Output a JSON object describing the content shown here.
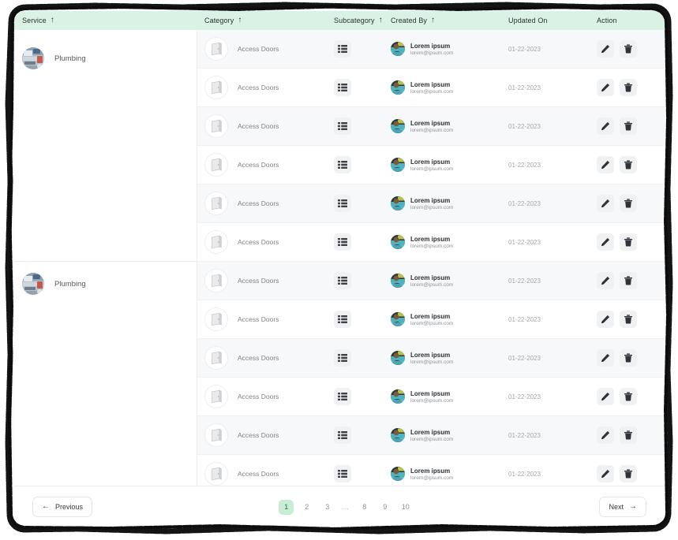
{
  "theme": {
    "header_bg": "#d9f2e3",
    "active_page_bg": "#c9ecd5",
    "active_page_fg": "#2f6b45",
    "row_alt_bg": "#f7f8f9",
    "icon_btn_bg": "#f0f1f3"
  },
  "table": {
    "columns": [
      {
        "key": "service",
        "label": "Service",
        "sortable": true,
        "sort_icon": "sort-arrow-up-icon"
      },
      {
        "key": "category",
        "label": "Category",
        "sortable": true,
        "sort_icon": "sort-arrow-up-icon"
      },
      {
        "key": "subcategory",
        "label": "Subcategory",
        "sortable": true,
        "sort_icon": "sort-arrow-up-icon"
      },
      {
        "key": "created_by",
        "label": "Created By",
        "sortable": true,
        "sort_icon": "sort-arrow-up-icon"
      },
      {
        "key": "updated_on",
        "label": "Updated On",
        "sortable": false,
        "sort_icon": ""
      },
      {
        "key": "action",
        "label": "Action",
        "sortable": false,
        "sort_icon": ""
      }
    ],
    "groups": [
      {
        "service": "Plumbing",
        "avatar": "plumbing-tools-photo",
        "row_count": 6
      },
      {
        "service": "Plumbing",
        "avatar": "plumbing-tools-photo",
        "row_count": 6
      }
    ],
    "rows": [
      {
        "category": "Access Doors",
        "category_thumb": "access-door-photo",
        "subcategory_icon": "list-view-icon",
        "created_by_name": "Lorem ipsum",
        "created_by_email": "lorem@ipsum.com",
        "created_by_avatar": "person-photo",
        "updated_on": "01-22-2023",
        "edit_icon": "pencil-icon",
        "delete_icon": "trash-icon"
      },
      {
        "category": "Access Doors",
        "category_thumb": "access-door-photo",
        "subcategory_icon": "list-view-icon",
        "created_by_name": "Lorem ipsum",
        "created_by_email": "lorem@ipsum.com",
        "created_by_avatar": "person-photo",
        "updated_on": "01-22-2023",
        "edit_icon": "pencil-icon",
        "delete_icon": "trash-icon"
      },
      {
        "category": "Access Doors",
        "category_thumb": "access-door-photo",
        "subcategory_icon": "list-view-icon",
        "created_by_name": "Lorem ipsum",
        "created_by_email": "lorem@ipsum.com",
        "created_by_avatar": "person-photo",
        "updated_on": "01-22-2023",
        "edit_icon": "pencil-icon",
        "delete_icon": "trash-icon"
      },
      {
        "category": "Access Doors",
        "category_thumb": "access-door-photo",
        "subcategory_icon": "list-view-icon",
        "created_by_name": "Lorem ipsum",
        "created_by_email": "lorem@ipsum.com",
        "created_by_avatar": "person-photo",
        "updated_on": "01-22-2023",
        "edit_icon": "pencil-icon",
        "delete_icon": "trash-icon"
      },
      {
        "category": "Access Doors",
        "category_thumb": "access-door-photo",
        "subcategory_icon": "list-view-icon",
        "created_by_name": "Lorem ipsum",
        "created_by_email": "lorem@ipsum.com",
        "created_by_avatar": "person-photo",
        "updated_on": "01-22-2023",
        "edit_icon": "pencil-icon",
        "delete_icon": "trash-icon"
      },
      {
        "category": "Access Doors",
        "category_thumb": "access-door-photo",
        "subcategory_icon": "list-view-icon",
        "created_by_name": "Lorem ipsum",
        "created_by_email": "lorem@ipsum.com",
        "created_by_avatar": "person-photo",
        "updated_on": "01-22-2023",
        "edit_icon": "pencil-icon",
        "delete_icon": "trash-icon"
      },
      {
        "category": "Access Doors",
        "category_thumb": "access-door-photo",
        "subcategory_icon": "list-view-icon",
        "created_by_name": "Lorem ipsum",
        "created_by_email": "lorem@ipsum.com",
        "created_by_avatar": "person-photo",
        "updated_on": "01-22-2023",
        "edit_icon": "pencil-icon",
        "delete_icon": "trash-icon"
      },
      {
        "category": "Access Doors",
        "category_thumb": "access-door-photo",
        "subcategory_icon": "list-view-icon",
        "created_by_name": "Lorem ipsum",
        "created_by_email": "lorem@ipsum.com",
        "created_by_avatar": "person-photo",
        "updated_on": "01-22-2023",
        "edit_icon": "pencil-icon",
        "delete_icon": "trash-icon"
      },
      {
        "category": "Access Doors",
        "category_thumb": "access-door-photo",
        "subcategory_icon": "list-view-icon",
        "created_by_name": "Lorem ipsum",
        "created_by_email": "lorem@ipsum.com",
        "created_by_avatar": "person-photo",
        "updated_on": "01-22-2023",
        "edit_icon": "pencil-icon",
        "delete_icon": "trash-icon"
      },
      {
        "category": "Access Doors",
        "category_thumb": "access-door-photo",
        "subcategory_icon": "list-view-icon",
        "created_by_name": "Lorem ipsum",
        "created_by_email": "lorem@ipsum.com",
        "created_by_avatar": "person-photo",
        "updated_on": "01-22-2023",
        "edit_icon": "pencil-icon",
        "delete_icon": "trash-icon"
      },
      {
        "category": "Access Doors",
        "category_thumb": "access-door-photo",
        "subcategory_icon": "list-view-icon",
        "created_by_name": "Lorem ipsum",
        "created_by_email": "lorem@ipsum.com",
        "created_by_avatar": "person-photo",
        "updated_on": "01-22-2023",
        "edit_icon": "pencil-icon",
        "delete_icon": "trash-icon"
      },
      {
        "category": "Access Doors",
        "category_thumb": "access-door-photo",
        "subcategory_icon": "list-view-icon",
        "created_by_name": "Lorem ipsum",
        "created_by_email": "lorem@ipsum.com",
        "created_by_avatar": "person-photo",
        "updated_on": "01-22-2023",
        "edit_icon": "pencil-icon",
        "delete_icon": "trash-icon"
      }
    ]
  },
  "pagination": {
    "previous_label": "Previous",
    "previous_icon": "arrow-left-icon",
    "next_label": "Next",
    "next_icon": "arrow-right-icon",
    "pages": [
      "1",
      "2",
      "3",
      "…",
      "8",
      "9",
      "10"
    ],
    "current_page": "1",
    "ellipsis": "…"
  }
}
